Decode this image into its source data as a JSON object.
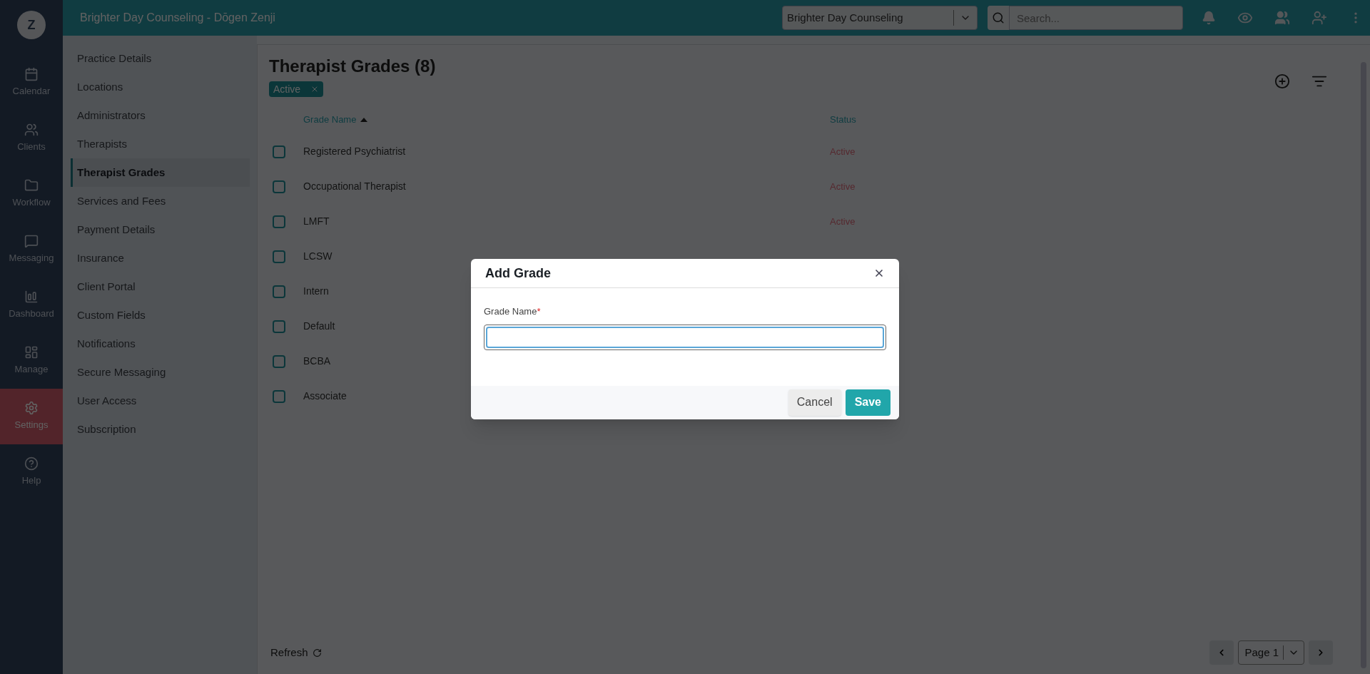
{
  "avatar": {
    "initial": "Z"
  },
  "header": {
    "title": "Brighter Day Counseling - Dōgen Zenji",
    "practice_select": "Brighter Day Counseling",
    "search": {
      "placeholder": "Search..."
    }
  },
  "nav": [
    {
      "kind": "calendar",
      "label": "Calendar",
      "selected": false
    },
    {
      "kind": "clients",
      "label": "Clients",
      "selected": false
    },
    {
      "kind": "workflow",
      "label": "Workflow",
      "selected": false
    },
    {
      "kind": "messaging",
      "label": "Messaging",
      "selected": false
    },
    {
      "kind": "dashboard",
      "label": "Dashboard",
      "selected": false
    },
    {
      "kind": "manage",
      "label": "Manage",
      "selected": false
    },
    {
      "kind": "settings",
      "label": "Settings",
      "selected": true
    },
    {
      "kind": "help",
      "label": "Help",
      "selected": false
    }
  ],
  "settings_menu": [
    {
      "label": "Practice Details",
      "selected": false
    },
    {
      "label": "Locations",
      "selected": false
    },
    {
      "label": "Administrators",
      "selected": false
    },
    {
      "label": "Therapists",
      "selected": false
    },
    {
      "label": "Therapist Grades",
      "selected": true
    },
    {
      "label": "Services and Fees",
      "selected": false
    },
    {
      "label": "Payment Details",
      "selected": false
    },
    {
      "label": "Insurance",
      "selected": false
    },
    {
      "label": "Client Portal",
      "selected": false
    },
    {
      "label": "Custom Fields",
      "selected": false
    },
    {
      "label": "Notifications",
      "selected": false
    },
    {
      "label": "Secure Messaging",
      "selected": false
    },
    {
      "label": "User Access",
      "selected": false
    },
    {
      "label": "Subscription",
      "selected": false
    }
  ],
  "page": {
    "title": "Therapist Grades (8)",
    "filter_tag": "Active"
  },
  "table": {
    "columns": [
      "Grade Name",
      "Status"
    ],
    "rows": [
      {
        "name": "Registered Psychiatrist",
        "status": "Active",
        "checked": false
      },
      {
        "name": "Occupational Therapist",
        "status": "Active",
        "checked": false
      },
      {
        "name": "LMFT",
        "status": "Active",
        "checked": false
      },
      {
        "name": "LCSW",
        "checked": false
      },
      {
        "name": "Intern",
        "checked": false
      },
      {
        "name": "Default",
        "checked": false
      },
      {
        "name": "BCBA",
        "checked": false
      },
      {
        "name": "Associate",
        "checked": false
      }
    ]
  },
  "footer": {
    "refresh": "Refresh",
    "page_select": "Page 1"
  },
  "modal": {
    "title": "Add Grade",
    "field_label": "Grade Name",
    "required_mark": "*",
    "buttons": [
      "Cancel",
      "Save"
    ]
  }
}
